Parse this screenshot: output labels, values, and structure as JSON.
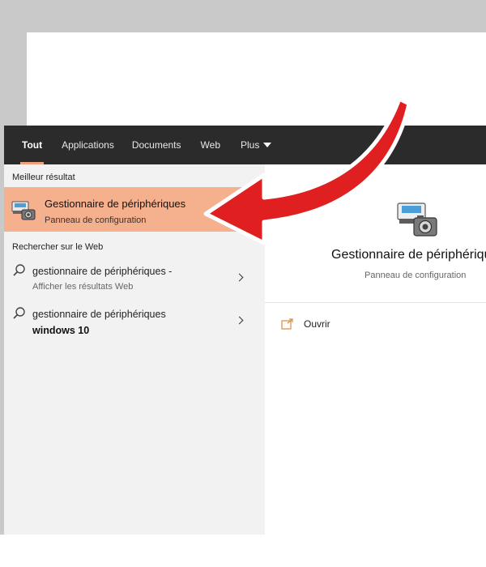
{
  "tabs": [
    {
      "label": "Tout",
      "active": true
    },
    {
      "label": "Applications"
    },
    {
      "label": "Documents"
    },
    {
      "label": "Web"
    },
    {
      "label": "Plus"
    }
  ],
  "sections": {
    "best": "Meilleur résultat",
    "web": "Rechercher sur le Web"
  },
  "best_result": {
    "title": "Gestionnaire de périphériques",
    "subtitle": "Panneau de configuration",
    "icon": "device-manager-icon"
  },
  "web_results": [
    {
      "line1": "gestionnaire de périphériques -",
      "line2": "Afficher les résultats Web"
    },
    {
      "line1": "gestionnaire de périphériques",
      "line2": "windows 10"
    }
  ],
  "detail": {
    "title": "Gestionnaire de périphériques",
    "subtitle": "Panneau de configuration",
    "open_label": "Ouvrir"
  },
  "colors": {
    "accent": "#f0a07a",
    "highlight": "#f5b08e",
    "arrow": "#e02020",
    "topbar": "#2b2b2b"
  }
}
